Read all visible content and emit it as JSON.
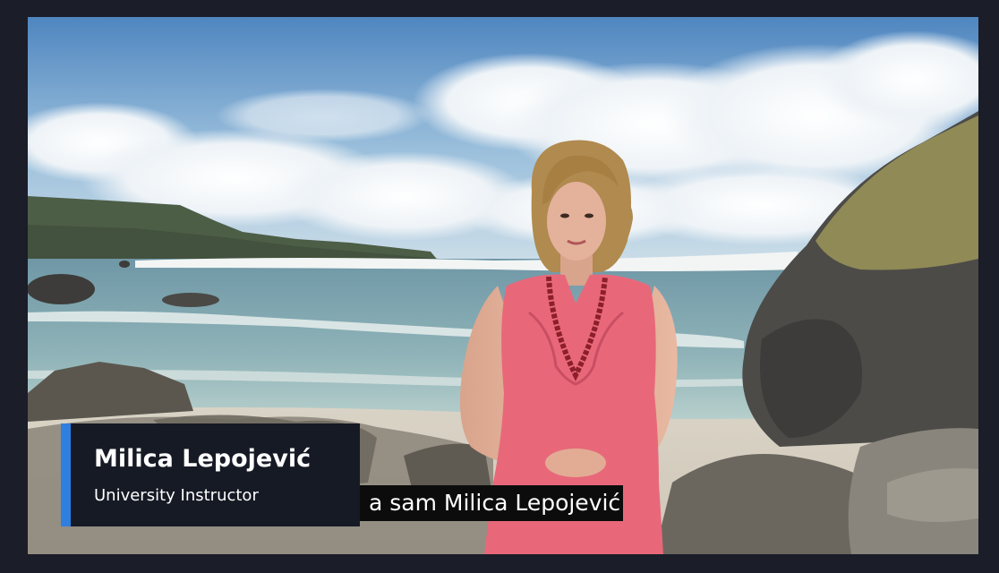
{
  "lower_third": {
    "name": "Milica Lepojević",
    "title": "University Instructor"
  },
  "subtitle": {
    "text": "a sam Milica Lepojević"
  },
  "colors": {
    "frame": "#1b1d29",
    "accent": "#2e7fe0",
    "lower_third_bg": "#161a24",
    "caption_bg": "#0c0c0c",
    "dress": "#e8687a"
  }
}
